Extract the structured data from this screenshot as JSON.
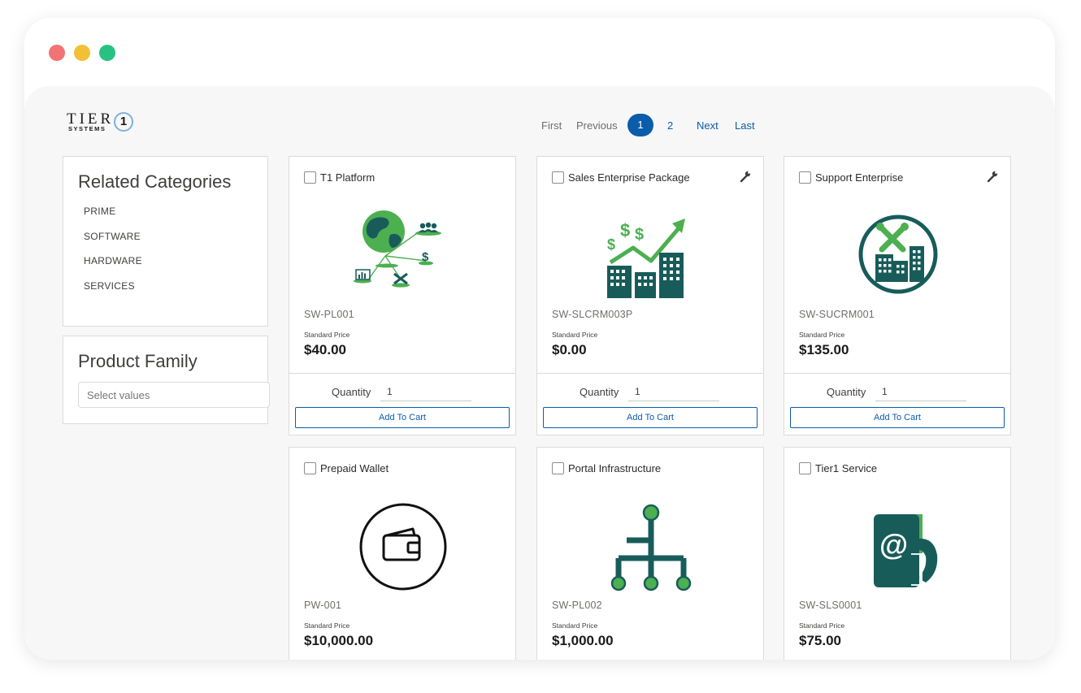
{
  "logo": {
    "word": "TIER",
    "sub": "SYSTEMS",
    "badge": "1"
  },
  "pagination": {
    "first": "First",
    "previous": "Previous",
    "pages": [
      "1",
      "2"
    ],
    "current": "1",
    "next": "Next",
    "last": "Last"
  },
  "related_categories": {
    "title": "Related Categories",
    "items": [
      "PRIME",
      "SOFTWARE",
      "HARDWARE",
      "SERVICES"
    ]
  },
  "product_family": {
    "title": "Product Family",
    "placeholder": "Select values"
  },
  "labels": {
    "standard_price": "Standard Price",
    "quantity": "Quantity",
    "add_to_cart": "Add To Cart"
  },
  "products": [
    {
      "name": "T1 Platform",
      "sku": "SW-PL001",
      "price": "$40.00",
      "quantity": "1",
      "icon": "globe-network-icon",
      "wrench": false
    },
    {
      "name": "Sales Enterprise Package",
      "sku": "SW-SLCRM003P",
      "price": "$0.00",
      "quantity": "1",
      "icon": "city-growth-icon",
      "wrench": true
    },
    {
      "name": "Support Enterprise",
      "sku": "SW-SUCRM001",
      "price": "$135.00",
      "quantity": "1",
      "icon": "support-city-icon",
      "wrench": true
    },
    {
      "name": "Prepaid Wallet",
      "sku": "PW-001",
      "price": "$10,000.00",
      "icon": "wallet-icon",
      "wrench": false
    },
    {
      "name": "Portal Infrastructure",
      "sku": "SW-PL002",
      "price": "$1,000.00",
      "icon": "hierarchy-icon",
      "wrench": false
    },
    {
      "name": "Tier1 Service",
      "sku": "SW-SLS0001",
      "price": "$75.00",
      "icon": "email-phone-icon",
      "wrench": false
    }
  ],
  "colors": {
    "brand": "#0b5cab",
    "green": "#4caf50",
    "teal": "#185c5a"
  }
}
